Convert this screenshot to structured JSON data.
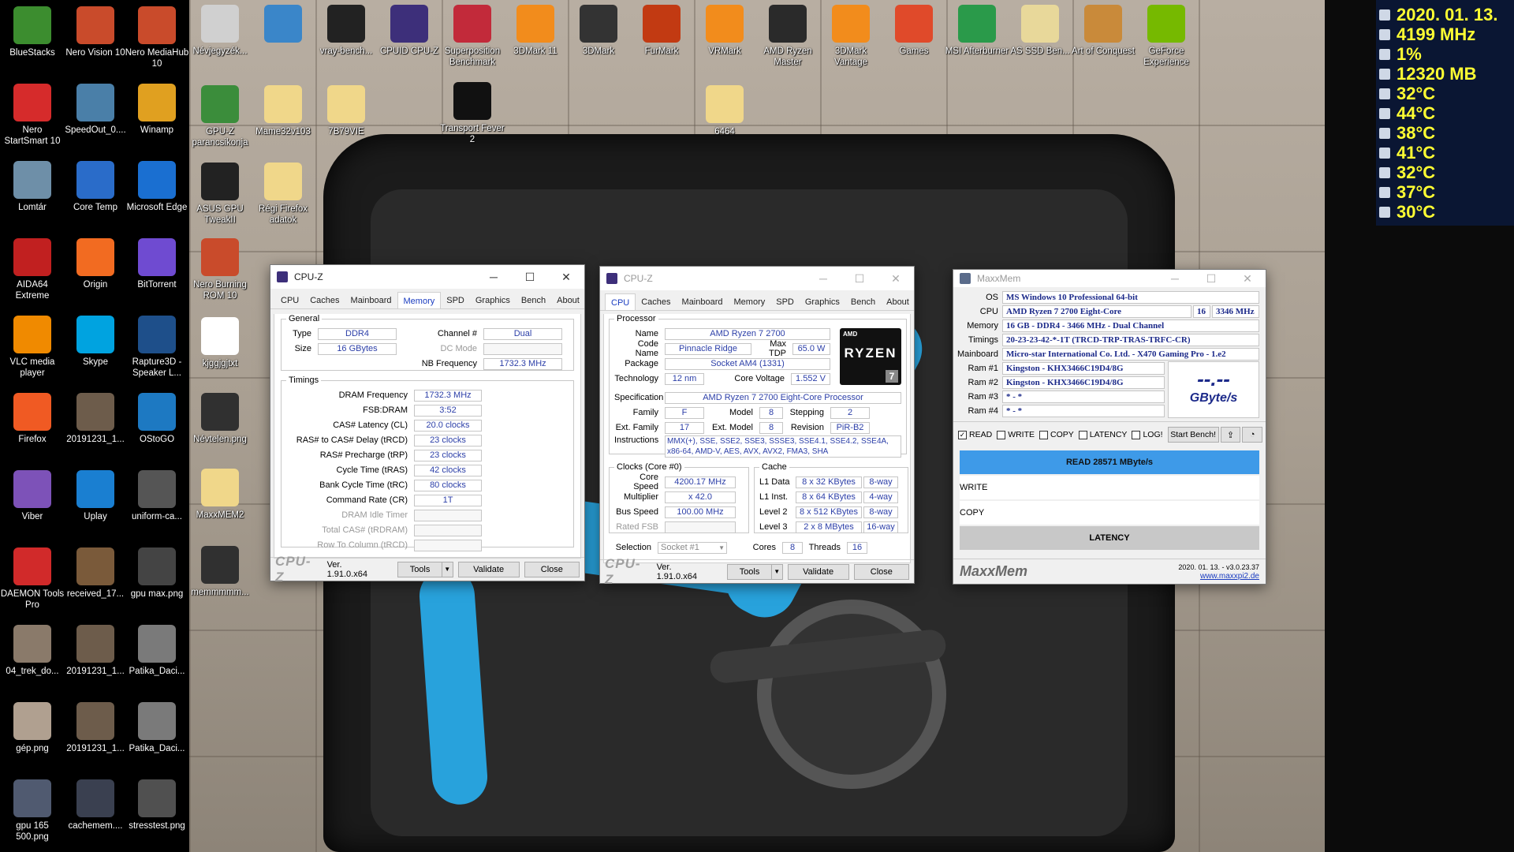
{
  "desktop_icons": [
    {
      "label": "BlueStacks",
      "color": "#3c8d2f"
    },
    {
      "label": "Nero Vision 10",
      "color": "#c94b2b"
    },
    {
      "label": "Nero MediaHub 10",
      "color": "#c94b2b"
    },
    {
      "label": "Nero StartSmart 10",
      "color": "#d62b2b"
    },
    {
      "label": "SpeedOut_0....",
      "color": "#4a7fa8"
    },
    {
      "label": "Winamp",
      "color": "#e0a020"
    },
    {
      "label": "Lomtár",
      "color": "#6e8fa8"
    },
    {
      "label": "Core Temp",
      "color": "#2a6cc9"
    },
    {
      "label": "Microsoft Edge",
      "color": "#1a6fd1"
    },
    {
      "label": "AIDA64 Extreme",
      "color": "#c12020"
    },
    {
      "label": "Origin",
      "color": "#f26b21"
    },
    {
      "label": "BitTorrent",
      "color": "#6f4bd1"
    },
    {
      "label": "VLC media player",
      "color": "#f08a00"
    },
    {
      "label": "Skype",
      "color": "#00a3e0"
    },
    {
      "label": "Rapture3D - Speaker L...",
      "color": "#1e4f8a"
    },
    {
      "label": "Firefox",
      "color": "#f05a23"
    },
    {
      "label": "20191231_1...",
      "color": "#6d5c4b"
    },
    {
      "label": "OStoGO",
      "color": "#1d79c2"
    },
    {
      "label": "Viber",
      "color": "#7d52b8"
    },
    {
      "label": "Uplay",
      "color": "#1a7fd1"
    },
    {
      "label": "uniform-ca...",
      "color": "#555555"
    },
    {
      "label": "DAEMON Tools Pro",
      "color": "#d12a2a"
    },
    {
      "label": "received_17...",
      "color": "#7a5a3a"
    },
    {
      "label": "gpu max.png",
      "color": "#444444"
    },
    {
      "label": "04_trek_do...",
      "color": "#8a7a6a"
    },
    {
      "label": "20191231_1...",
      "color": "#6d5c4b"
    },
    {
      "label": "Patika_Daci...",
      "color": "#7a7a7a"
    },
    {
      "label": "gép.png",
      "color": "#b0a090"
    },
    {
      "label": "20191231_1...",
      "color": "#6d5c4b"
    },
    {
      "label": "Patika_Daci...",
      "color": "#7a7a7a"
    },
    {
      "label": "gpu 165 500.png",
      "color": "#505a70"
    },
    {
      "label": "cachemem....",
      "color": "#3a4050"
    },
    {
      "label": "stresstest.png",
      "color": "#505050"
    },
    {
      "label": "Névjegyzék...",
      "color": "#d0d0d0"
    },
    {
      "label": "",
      "color": "#3a86c9"
    },
    {
      "label": "vray-bench...",
      "color": "#222222"
    },
    {
      "label": "CPUID CPU-Z",
      "color": "#3d2f7a"
    },
    {
      "label": "Superposition Benchmark",
      "color": "#c22a3a"
    },
    {
      "label": "3DMark 11",
      "color": "#f28c1c"
    },
    {
      "label": "3DMark",
      "color": "#333333"
    },
    {
      "label": "FurMark",
      "color": "#c23a12"
    },
    {
      "label": "VRMark",
      "color": "#f28c1c"
    },
    {
      "label": "AMD Ryzen Master",
      "color": "#2a2a2a"
    },
    {
      "label": "3DMark Vantage",
      "color": "#f28c1c"
    },
    {
      "label": "Games",
      "color": "#e04a2a"
    },
    {
      "label": "MSI Afterburner",
      "color": "#2a9a4a"
    },
    {
      "label": "AS SSD Ben...",
      "color": "#e8d89a"
    },
    {
      "label": "Art of Conquest",
      "color": "#c98a3a"
    },
    {
      "label": "GeForce Experience",
      "color": "#76b900"
    },
    {
      "label": "GPU-Z parancsikonja",
      "color": "#3b8d3b"
    },
    {
      "label": "Mame32v103",
      "color": "#f0d78a"
    },
    {
      "label": "7B79VIE",
      "color": "#f0d78a"
    },
    {
      "label": "Transport Fever 2",
      "color": "#111111"
    },
    {
      "label": "6464",
      "color": "#f0d78a"
    },
    {
      "label": "ASUS GPU TweakII",
      "color": "#222222"
    },
    {
      "label": "Régi Firefox adatok",
      "color": "#f0d78a"
    },
    {
      "label": "Nero Burning ROM 10",
      "color": "#c94b2b"
    },
    {
      "label": "kjggjgjtxt",
      "color": "#ffffff"
    },
    {
      "label": "Névtelen.png",
      "color": "#303030"
    },
    {
      "label": "MaxxMEM2",
      "color": "#f0d78a"
    },
    {
      "label": "memmmmm...",
      "color": "#303030"
    }
  ],
  "osd": [
    {
      "value": "2020. 01. 13."
    },
    {
      "value": "4199 MHz"
    },
    {
      "value": "1%"
    },
    {
      "value": "12320 MB"
    },
    {
      "value": "32°C"
    },
    {
      "value": "44°C"
    },
    {
      "value": "38°C"
    },
    {
      "value": "41°C"
    },
    {
      "value": "32°C"
    },
    {
      "value": "37°C"
    },
    {
      "value": "30°C"
    }
  ],
  "osd_color": "#ffff33",
  "cpuz_mem": {
    "title": "CPU-Z",
    "tabs": [
      "CPU",
      "Caches",
      "Mainboard",
      "Memory",
      "SPD",
      "Graphics",
      "Bench",
      "About"
    ],
    "active_tab": "Memory",
    "general_legend": "General",
    "type_label": "Type",
    "type_value": "DDR4",
    "size_label": "Size",
    "size_value": "16 GBytes",
    "channel_label": "Channel #",
    "channel_value": "Dual",
    "dcmode_label": "DC Mode",
    "dcmode_value": "",
    "nbfreq_label": "NB Frequency",
    "nbfreq_value": "1732.3 MHz",
    "timings_legend": "Timings",
    "timings": [
      {
        "label": "DRAM Frequency",
        "value": "1732.3 MHz",
        "dim": false
      },
      {
        "label": "FSB:DRAM",
        "value": "3:52",
        "dim": false
      },
      {
        "label": "CAS# Latency (CL)",
        "value": "20.0 clocks",
        "dim": false
      },
      {
        "label": "RAS# to CAS# Delay (tRCD)",
        "value": "23 clocks",
        "dim": false
      },
      {
        "label": "RAS# Precharge (tRP)",
        "value": "23 clocks",
        "dim": false
      },
      {
        "label": "Cycle Time (tRAS)",
        "value": "42 clocks",
        "dim": false
      },
      {
        "label": "Bank Cycle Time (tRC)",
        "value": "80 clocks",
        "dim": false
      },
      {
        "label": "Command Rate (CR)",
        "value": "1T",
        "dim": false
      },
      {
        "label": "DRAM Idle Timer",
        "value": "",
        "dim": true
      },
      {
        "label": "Total CAS# (tRDRAM)",
        "value": "",
        "dim": true
      },
      {
        "label": "Row To Column (tRCD)",
        "value": "",
        "dim": true
      }
    ],
    "logo": "CPU-Z",
    "version": "Ver. 1.91.0.x64",
    "tools_label": "Tools",
    "validate_label": "Validate",
    "close_label": "Close"
  },
  "cpuz_cpu": {
    "title": "CPU-Z",
    "tabs": [
      "CPU",
      "Caches",
      "Mainboard",
      "Memory",
      "SPD",
      "Graphics",
      "Bench",
      "About"
    ],
    "active_tab": "CPU",
    "processor_legend": "Processor",
    "name_label": "Name",
    "name_value": "AMD Ryzen 7 2700",
    "codename_label": "Code Name",
    "codename_value": "Pinnacle Ridge",
    "maxtdp_label": "Max TDP",
    "maxtdp_value": "65.0 W",
    "package_label": "Package",
    "package_value": "Socket AM4 (1331)",
    "technology_label": "Technology",
    "technology_value": "12 nm",
    "corevoltage_label": "Core Voltage",
    "corevoltage_value": "1.552 V",
    "spec_label": "Specification",
    "spec_value": "AMD Ryzen 7 2700 Eight-Core Processor",
    "family_label": "Family",
    "family_value": "F",
    "model_label": "Model",
    "model_value": "8",
    "stepping_label": "Stepping",
    "stepping_value": "2",
    "extfamily_label": "Ext. Family",
    "extfamily_value": "17",
    "extmodel_label": "Ext. Model",
    "extmodel_value": "8",
    "revision_label": "Revision",
    "revision_value": "PiR-B2",
    "instructions_label": "Instructions",
    "instructions_value": "MMX(+), SSE, SSE2, SSE3, SSSE3, SSE4.1, SSE4.2, SSE4A, x86-64, AMD-V, AES, AVX, AVX2, FMA3, SHA",
    "clocks_legend": "Clocks (Core #0)",
    "corespeed_label": "Core Speed",
    "corespeed_value": "4200.17 MHz",
    "multiplier_label": "Multiplier",
    "multiplier_value": "x 42.0",
    "busspeed_label": "Bus Speed",
    "busspeed_value": "100.00 MHz",
    "ratedfsb_label": "Rated FSB",
    "ratedfsb_value": "",
    "cache_legend": "Cache",
    "cache": [
      {
        "label": "L1 Data",
        "size": "8 x 32 KBytes",
        "way": "8-way"
      },
      {
        "label": "L1 Inst.",
        "size": "8 x 64 KBytes",
        "way": "4-way"
      },
      {
        "label": "Level 2",
        "size": "8 x 512 KBytes",
        "way": "8-way"
      },
      {
        "label": "Level 3",
        "size": "2 x 8 MBytes",
        "way": "16-way"
      }
    ],
    "selection_label": "Selection",
    "selection_value": "Socket #1",
    "cores_label": "Cores",
    "cores_value": "8",
    "threads_label": "Threads",
    "threads_value": "16",
    "ryzen_logo_top": "AMD",
    "ryzen_logo_main": "RYZEN",
    "ryzen_logo_num": "7",
    "logo": "CPU-Z",
    "version": "Ver. 1.91.0.x64",
    "tools_label": "Tools",
    "validate_label": "Validate",
    "close_label": "Close"
  },
  "maxxmem": {
    "title": "MaxxMem",
    "os_label": "OS",
    "os_value": "MS Windows 10 Professional 64-bit",
    "cpu_label": "CPU",
    "cpu_value": "AMD Ryzen 7 2700 Eight-Core",
    "cpu_threads": "16",
    "cpu_mhz": "3346 MHz",
    "memory_label": "Memory",
    "memory_value": "16 GB - DDR4 - 3466 MHz - Dual Channel",
    "timings_label": "Timings",
    "timings_value": "20-23-23-42-*-1T (TRCD-TRP-TRAS-TRFC-CR)",
    "mainboard_label": "Mainboard",
    "mainboard_value": "Micro-star International Co. Ltd. - X470 Gaming Pro - 1.e2",
    "ram": [
      {
        "label": "Ram #1",
        "value": "Kingston - KHX3466C19D4/8G"
      },
      {
        "label": "Ram #2",
        "value": "Kingston - KHX3466C19D4/8G"
      },
      {
        "label": "Ram #3",
        "value": "* - *"
      },
      {
        "label": "Ram #4",
        "value": "* - *"
      }
    ],
    "big_value": "--.--",
    "big_unit": "GByte/s",
    "checks": [
      {
        "label": "READ",
        "checked": true
      },
      {
        "label": "WRITE",
        "checked": false
      },
      {
        "label": "COPY",
        "checked": false
      },
      {
        "label": "LATENCY",
        "checked": false
      },
      {
        "label": "LOG!",
        "checked": false
      }
    ],
    "start_bench_label": "Start Bench!",
    "read_result": "READ  28571  MByte/s",
    "write_label": "WRITE",
    "copy_label": "COPY",
    "latency_label": "LATENCY",
    "footer_logo": "MaxxMem",
    "footer_date": "2020. 01. 13. - v3.0.23.37",
    "footer_url": "www.maxxpi2.de",
    "read_bar_color": "#3e9ae8"
  }
}
